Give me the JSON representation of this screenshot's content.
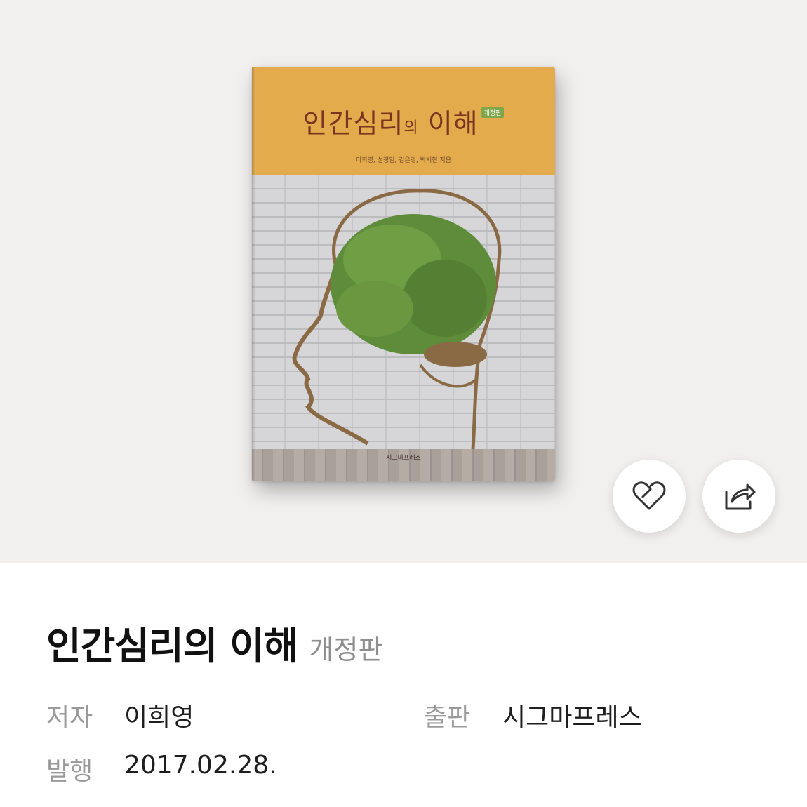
{
  "book": {
    "cover": {
      "title_main": "인간심리",
      "title_particle": "의",
      "title_rest": " 이해",
      "edition_badge": "개정판",
      "authors": "이희영, 성정임, 김은경, 박서현 지음",
      "publisher": "시그마프레스",
      "band_color": "#e4ab4d",
      "title_color": "#7a3420"
    },
    "title": "인간심리의 이해",
    "edition": "개정판"
  },
  "actions": {
    "like_icon": "heart-outline-icon",
    "share_icon": "share-icon"
  },
  "meta": {
    "author_label": "저자",
    "author_value": "이희영",
    "publisher_label": "출판",
    "publisher_value": "시그마프레스",
    "date_label": "발행",
    "date_value": "2017.02.28."
  }
}
